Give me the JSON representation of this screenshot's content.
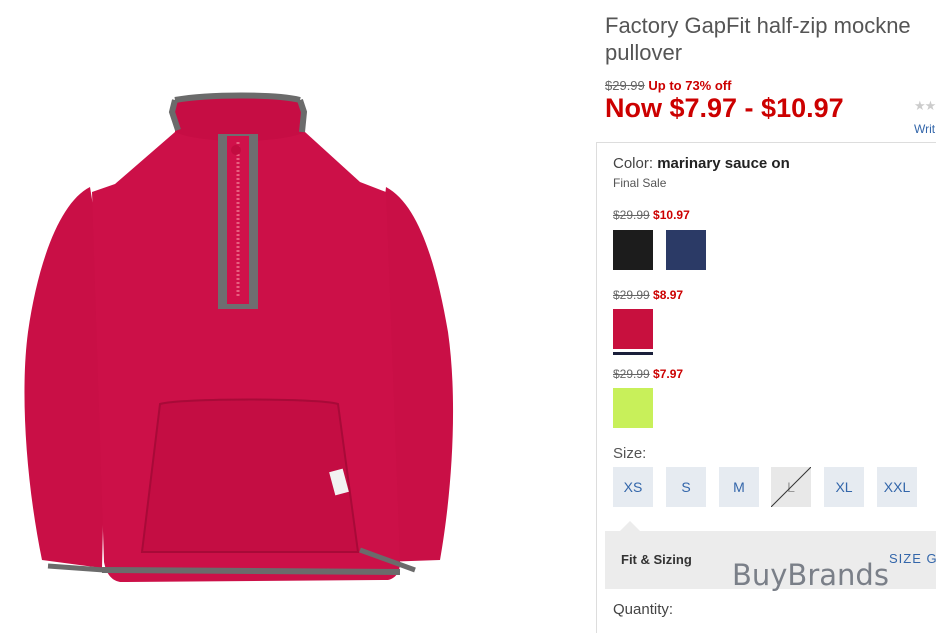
{
  "product": {
    "title_line1": "Factory GapFit half-zip mockne",
    "title_line2": "pullover",
    "original_price": "$29.99",
    "discount": "Up to 73% off",
    "now_price": "Now $7.97 - $10.97",
    "stars": "★★",
    "write_review": "Writ"
  },
  "color": {
    "label": "Color:",
    "selected": "marinary sauce on",
    "final_sale": "Final Sale"
  },
  "price_groups": [
    {
      "was": "$29.99",
      "now": "$10.97",
      "swatches": [
        {
          "name": "black",
          "color": "#1c1c1c"
        },
        {
          "name": "navy",
          "color": "#2b3a66"
        }
      ]
    },
    {
      "was": "$29.99",
      "now": "$8.97",
      "swatches": [
        {
          "name": "marinary sauce",
          "color": "#c8103e"
        }
      ]
    },
    {
      "was": "$29.99",
      "now": "$7.97",
      "swatches": [
        {
          "name": "lime",
          "color": "#c8f05a"
        }
      ]
    }
  ],
  "size": {
    "label": "Size:",
    "options": [
      "XS",
      "S",
      "M",
      "L",
      "XL",
      "XXL"
    ],
    "unavailable": "L"
  },
  "fit": {
    "label": "Fit & Sizing",
    "size_guide": "SIZE G"
  },
  "watermark": "BuyBrands",
  "quantity_label": "Quantity:"
}
